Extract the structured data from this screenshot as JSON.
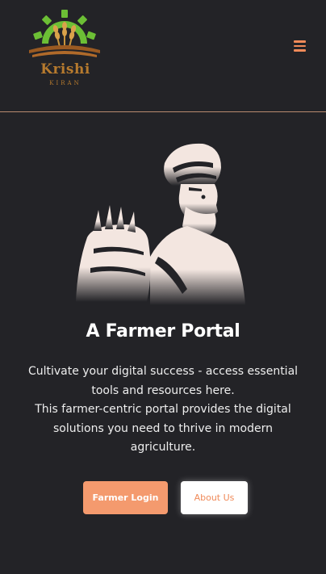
{
  "header": {
    "logo": {
      "name": "Krishi",
      "sub": "KIRAN"
    },
    "menu_icon": "hamburger-menu-icon"
  },
  "hero": {
    "illustration": "farmer-with-wheat-sack",
    "title": "A Farmer Portal",
    "paragraph1": "Cultivate your digital success - access essential tools and resources here.",
    "paragraph2": "This farmer-centric portal provides the digital solutions you need to thrive in modern agriculture."
  },
  "actions": {
    "login_label": "Farmer Login",
    "about_label": "About Us"
  },
  "colors": {
    "background": "#232327",
    "accent": "#f49a6e",
    "divider": "#b98a6f",
    "logo_green": "#6cbf35",
    "logo_gold": "#b67a2e"
  }
}
